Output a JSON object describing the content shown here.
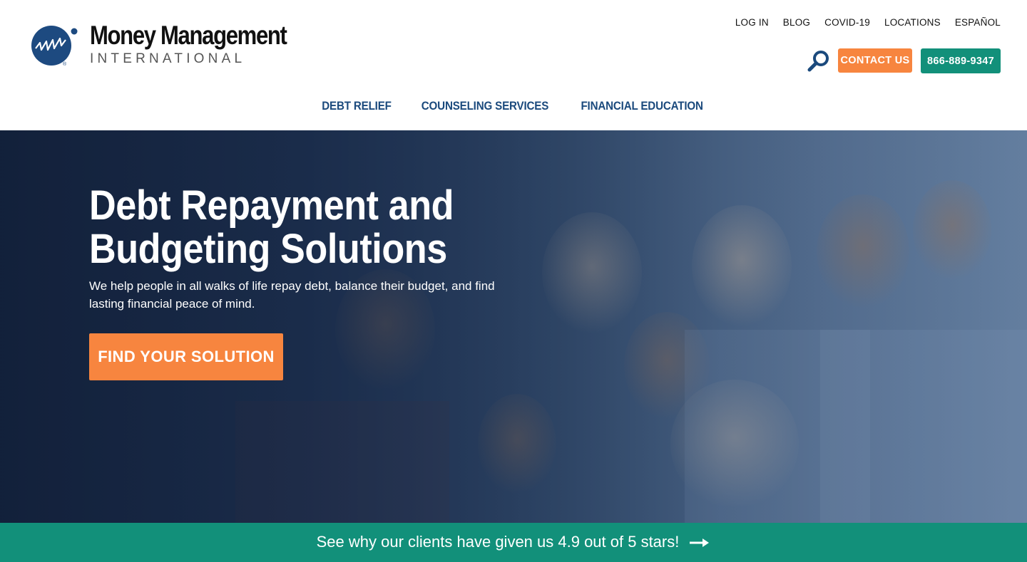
{
  "brand": {
    "name": "Money Management",
    "subtitle": "INTERNATIONAL",
    "logo_icon": "mmi-circle-logo-icon"
  },
  "utility_nav": {
    "items": [
      {
        "label": "LOG IN"
      },
      {
        "label": "BLOG"
      },
      {
        "label": "COVID-19"
      },
      {
        "label": "LOCATIONS"
      },
      {
        "label": "ESPAÑOL"
      }
    ]
  },
  "header_actions": {
    "search_icon": "search-icon",
    "contact_label": "CONTACT US",
    "phone_label": "866-889-9347"
  },
  "main_nav": {
    "items": [
      {
        "label": "DEBT RELIEF"
      },
      {
        "label": "COUNSELING SERVICES"
      },
      {
        "label": "FINANCIAL EDUCATION"
      }
    ]
  },
  "hero": {
    "title": "Debt Repayment and Budgeting Solutions",
    "text": "We help people in all walks of life repay debt, balance their budget, and find lasting financial peace of mind.",
    "cta_label": "FIND YOUR SOLUTION"
  },
  "reviews_banner": {
    "text": "See why our clients have given us 4.9 out of 5 stars!",
    "icon": "arrow-right-icon"
  },
  "colors": {
    "orange": "#f7853f",
    "teal": "#12907a",
    "navy": "#1b4a7d"
  }
}
